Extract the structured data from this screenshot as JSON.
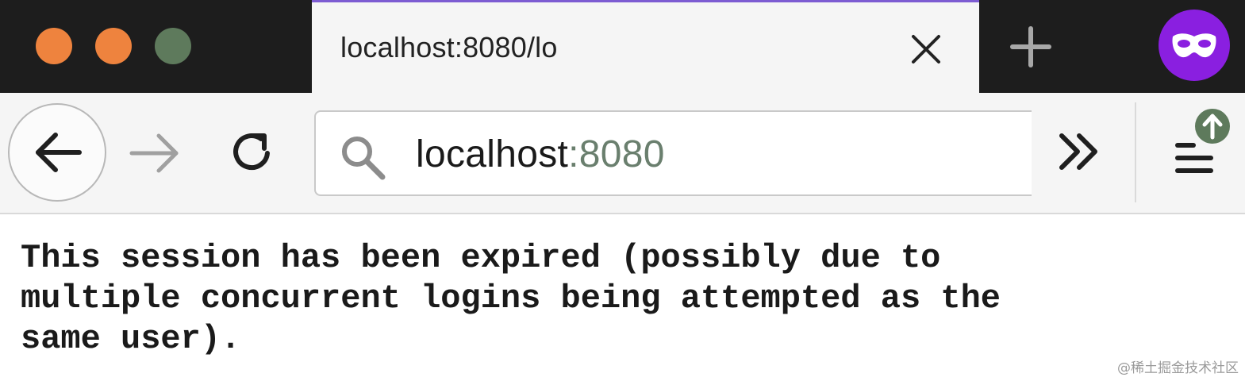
{
  "browser": {
    "tab": {
      "title": "localhost:8080/lo"
    },
    "urlbar": {
      "host": "localhost",
      "port": ":8080"
    }
  },
  "page": {
    "message": "This session has been expired (possibly due to\nmultiple concurrent logins being attempted as the\nsame user)."
  },
  "watermark": "@稀土掘金技术社区",
  "icons": {
    "traffic_lights": [
      "close-icon",
      "minimize-icon",
      "zoom-icon"
    ],
    "tab_close": "close-icon",
    "new_tab": "plus-icon",
    "private_browsing": "mask-icon",
    "back": "arrow-left-icon",
    "forward": "arrow-right-icon",
    "reload": "reload-icon",
    "search": "search-icon",
    "overflow": "chevron-double-right-icon",
    "menu": "hamburger-menu-icon",
    "update": "arrow-up-icon"
  },
  "colors": {
    "tabstrip_bg": "#1d1d1d",
    "traffic_close": "#ee833e",
    "traffic_minimize": "#ee833e",
    "traffic_zoom": "#5e7a5c",
    "tab_accent": "#7d5cd2",
    "private_badge": "#8a1fe0",
    "url_port": "#6a7f6e",
    "update_badge": "#5e7a5c"
  }
}
